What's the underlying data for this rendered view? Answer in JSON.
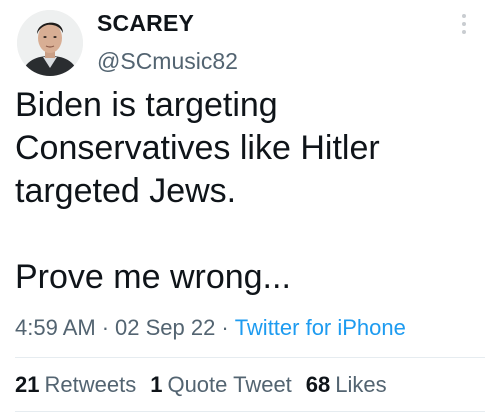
{
  "tweet": {
    "author": {
      "display_name": "SCAREY",
      "handle": "@SCmusic82"
    },
    "body_lines": [
      "Biden is targeting",
      "Conservatives like Hitler",
      "targeted Jews.",
      "",
      "Prove me wrong..."
    ],
    "meta": {
      "time": "4:59 AM",
      "separator": "·",
      "date": "02 Sep 22",
      "source": "Twitter for iPhone"
    },
    "stats": {
      "retweets_count": "21",
      "retweets_label": "Retweets",
      "quotes_count": "1",
      "quotes_label": "Quote Tweet",
      "likes_count": "68",
      "likes_label": "Likes"
    }
  },
  "icons": {
    "more": "more-vertical-icon"
  },
  "colors": {
    "text_primary": "#0f1419",
    "text_secondary": "#536471",
    "link": "#1d9bf0",
    "divider": "#e6ecf0"
  }
}
